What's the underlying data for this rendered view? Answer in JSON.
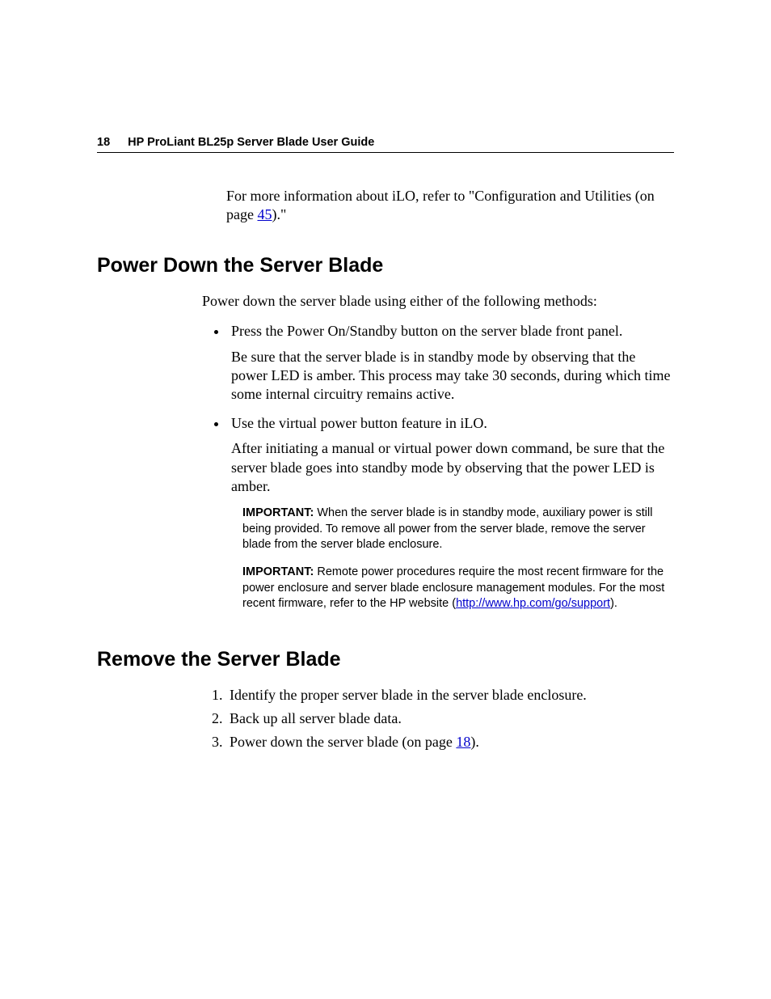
{
  "header": {
    "pageNumber": "18",
    "title": "HP ProLiant BL25p Server Blade User Guide"
  },
  "intro": {
    "part1": "For more information about iLO, refer to \"Configuration and Utilities (on page ",
    "link": "45",
    "part2": ").\""
  },
  "section1": {
    "heading": "Power Down the Server Blade",
    "lead": "Power down the server blade using either of the following methods:",
    "bullet1": {
      "text": "Press the Power On/Standby button on the server blade front panel.",
      "followup": "Be sure that the server blade is in standby mode by observing that the power LED is amber. This process may take 30 seconds, during which time some internal circuitry remains active."
    },
    "bullet2": {
      "text": "Use the virtual power button feature in iLO.",
      "followup": "After initiating a manual or virtual power down command, be sure that the server blade goes into standby mode by observing that the power LED is amber."
    },
    "note1": {
      "label": "IMPORTANT:",
      "text": "  When the server blade is in standby mode, auxiliary power is still being provided. To remove all power from the server blade, remove the server blade from the server blade enclosure."
    },
    "note2": {
      "label": "IMPORTANT:",
      "text1": "  Remote power procedures require the most recent firmware for the power enclosure and server blade enclosure management modules. For the most recent firmware, refer to the HP website (",
      "link": "http://www.hp.com/go/support",
      "text2": ")."
    }
  },
  "section2": {
    "heading": "Remove the Server Blade",
    "item1": "Identify the proper server blade in the server blade enclosure.",
    "item2": "Back up all server blade data.",
    "item3": {
      "part1": "Power down the server blade (on page ",
      "link": "18",
      "part2": ")."
    }
  }
}
